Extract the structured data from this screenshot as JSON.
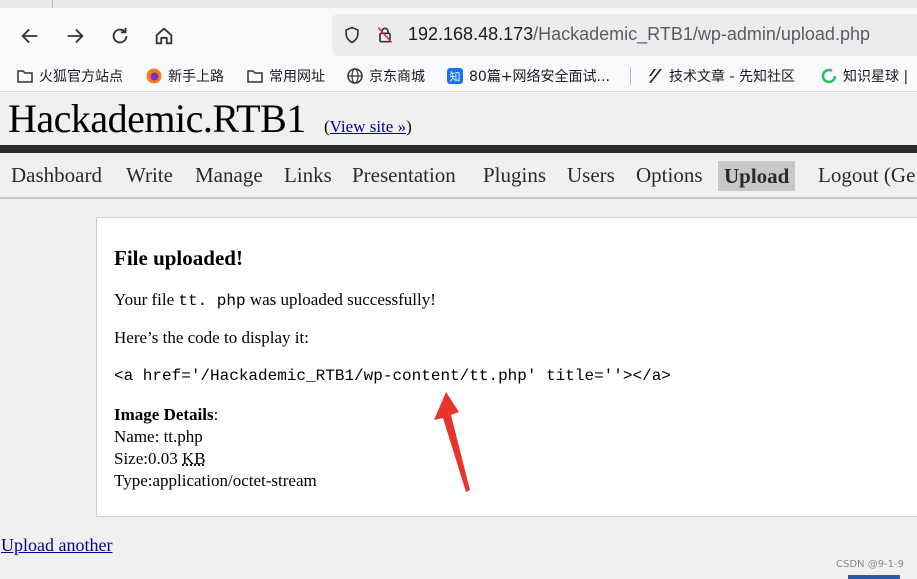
{
  "browser": {
    "url_host": "192.168.48.173",
    "url_path": "/Hackademic_RTB1/wp-admin/upload.php",
    "bookmarks": [
      {
        "label": "火狐官方站点",
        "icon": "folder-icon"
      },
      {
        "label": "新手上路",
        "icon": "firefox-icon"
      },
      {
        "label": "常用网址",
        "icon": "folder-icon"
      },
      {
        "label": "京东商城",
        "icon": "globe-icon"
      },
      {
        "label": "80篇+网络安全面试...",
        "icon": "zhihu-icon"
      },
      {
        "label": "技术文章 - 先知社区",
        "icon": "xianzhi-icon"
      },
      {
        "label": "知识星球 |",
        "icon": "zsxq-icon"
      }
    ]
  },
  "wp": {
    "site_title": "Hackademic.RTB1",
    "view_site_open": "(",
    "view_site": "View site »",
    "view_site_close": ")",
    "menu": [
      "Dashboard",
      "Write",
      "Manage",
      "Links",
      "Presentation",
      "Plugins",
      "Users",
      "Options",
      "Upload",
      "Logout (Ge"
    ],
    "active_menu": "Upload"
  },
  "panel": {
    "heading": "File uploaded!",
    "msg_prefix": "Your file",
    "msg_file": "tt. php",
    "msg_suffix": "was uploaded successfully!",
    "code_intro": "Here’s the code to display it:",
    "code": "<a href='/Hackademic_RTB1/wp-content/tt.php' title=''></a>",
    "details_label": "Image Details",
    "details_colon": ":",
    "name_line": "Name: tt.php",
    "size_prefix": "Size:0.03 ",
    "size_unit": "KB",
    "type_line": "Type:application/octet-stream"
  },
  "upload_another": "Upload another",
  "watermark": "CSDN @9-1-9",
  "colors": {
    "link": "#00019b",
    "arrow": "#e8342d",
    "headbar": "#2b2b2b"
  }
}
